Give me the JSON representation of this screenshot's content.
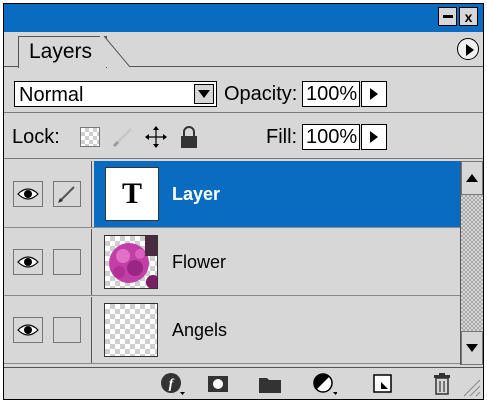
{
  "panel": {
    "tab_label": "Layers",
    "close_label": "x",
    "colors": {
      "titlebar": "#0a6cc0",
      "selected_row": "#0a6cc0",
      "panel_bg": "#d7d7d7"
    }
  },
  "blend": {
    "mode": "Normal",
    "opacity_label": "Opacity:",
    "opacity_value": "100%"
  },
  "lock": {
    "label": "Lock:",
    "fill_label": "Fill:",
    "fill_value": "100%",
    "icons": [
      "lock-transparent-pixels-icon",
      "lock-image-pixels-icon",
      "lock-position-icon",
      "lock-all-icon"
    ]
  },
  "layers": [
    {
      "name": "Layer",
      "type": "text",
      "selected": true,
      "visible": true,
      "thumb_text": "T"
    },
    {
      "name": "Flower",
      "type": "image",
      "selected": false,
      "visible": true
    },
    {
      "name": "Angels",
      "type": "transparent",
      "selected": false,
      "visible": true
    }
  ],
  "toolbar": {
    "icons": [
      "layer-style-icon",
      "add-mask-icon",
      "new-group-icon",
      "adjustment-layer-icon",
      "new-layer-icon",
      "trash-icon"
    ]
  }
}
